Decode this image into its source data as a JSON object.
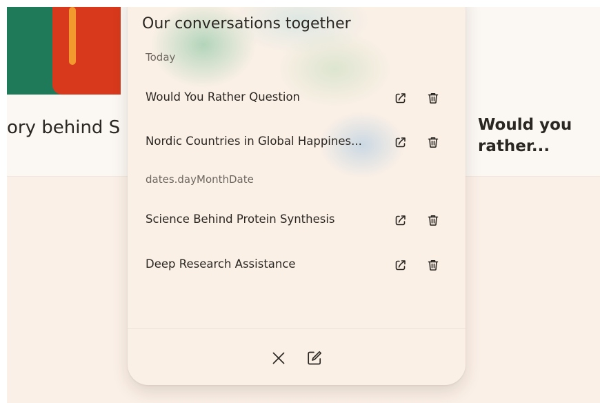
{
  "background": {
    "left_card_title": "ory behind S",
    "right_card_title": "Would you rather..."
  },
  "panel": {
    "title": "Our conversations together",
    "sections": [
      {
        "label": "Today",
        "items": [
          {
            "title": "Would You Rather Question"
          },
          {
            "title": "Nordic Countries in Global Happines..."
          }
        ]
      },
      {
        "label": "dates.dayMonthDate",
        "items": [
          {
            "title": "Science Behind Protein Synthesis"
          },
          {
            "title": "Deep Research Assistance"
          }
        ]
      }
    ],
    "icons": {
      "share": "share-icon",
      "delete": "trash-icon",
      "close": "close-icon",
      "compose": "new-chat-icon"
    }
  },
  "colors": {
    "page_bg": "#fbf0e7",
    "panel_bg": "#fbf0e6",
    "text": "#2a2622",
    "muted": "#6e6862"
  }
}
